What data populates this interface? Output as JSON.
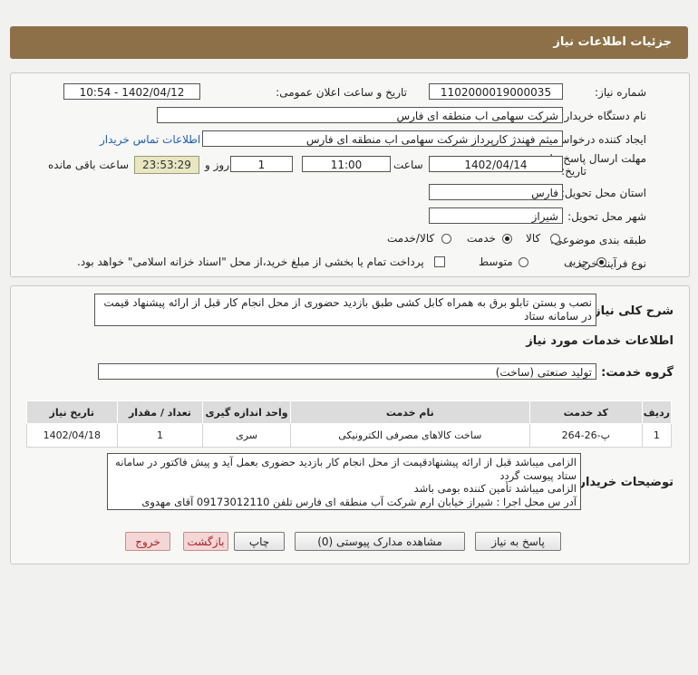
{
  "header": {
    "title": "جزئیات اطلاعات نیاز"
  },
  "form": {
    "need_number_label": "شماره نیاز:",
    "need_number": "1102000019000035",
    "announce_label": "تاریخ و ساعت اعلان عمومی:",
    "announce_value": "1402/04/12 - 10:54",
    "buyer_org_label": "نام دستگاه خریدار:",
    "buyer_org": "شرکت سهامی اب منطقه ای فارس",
    "requester_label": "ایجاد کننده درخواست:",
    "requester": "میثم فهندژ کارپرداز شرکت سهامی اب منطقه ای فارس",
    "contact_link": "اطلاعات تماس خریدار",
    "deadline_label_1": "مهلت ارسال پاسخ: تا",
    "deadline_label_2": "تاریخ:",
    "deadline_date": "1402/04/14",
    "time_label": "ساعت",
    "deadline_time": "11:00",
    "days_value": "1",
    "days_label": "روز و",
    "remaining_time": "23:53:29",
    "remaining_label": "ساعت باقی مانده",
    "province_label": "استان محل تحویل:",
    "province": "فارس",
    "city_label": "شهر محل تحویل:",
    "city": "شیراز",
    "category_label": "طبقه بندی موضوعی:",
    "category_options": [
      "کالا",
      "خدمت",
      "کالا/خدمت"
    ],
    "category_selected": "خدمت",
    "process_label": "نوع فرآیند خرید :",
    "process_options": [
      "جزیی",
      "متوسط"
    ],
    "process_selected": "جزیی",
    "payment_note": "پرداخت تمام یا بخشی از مبلغ خرید،از محل \"اسناد خزانه اسلامی\" خواهد بود."
  },
  "details": {
    "summary_label": "شرح کلی نیاز:",
    "summary": "نصب و بستن تابلو برق به همراه کابل کشی طبق بازدید حضوری از محل انجام کار قبل از ارائه پیشنهاد قیمت در سامانه ستاد",
    "services_title": "اطلاعات خدمات مورد نیاز",
    "service_group_label": "گروه خدمت:",
    "service_group": "تولید صنعتی (ساخت)",
    "table": {
      "headers": [
        "ردیف",
        "کد خدمت",
        "نام خدمت",
        "واحد اندازه گیری",
        "تعداد / مقدار",
        "تاریخ نیاز"
      ],
      "rows": [
        [
          "1",
          "پ-26-264",
          "ساخت کالاهای مصرفی الکترونیکی",
          "سری",
          "1",
          "1402/04/18"
        ]
      ]
    },
    "buyer_notes_label": "توضیحات خریدار:",
    "buyer_notes": [
      "الزامی میباشد قبل از ارائه پیشنهادقیمت از محل انجام کار بازدید حضوری بعمل آید و پیش فاکتور در سامانه ستاد پیوست گردد",
      "الزامی میباشد تأمین کننده بومی باشد",
      "آدر س محل اجرا : شیراز خیابان ارم شرکت آب منطقه ای فارس  تلفن 09173012110 آقای مهدوی"
    ]
  },
  "buttons": {
    "reply": "پاسخ به نیاز",
    "attachments": "مشاهده مدارک پیوستی (0)",
    "print": "چاپ",
    "back": "بازگشت",
    "exit": "خروج"
  },
  "colors": {
    "header_bg": "#8d7047",
    "contact_link": "#1f5fb0",
    "timer_bg": "#e9e6c2",
    "back_exit_bg": "#f3d6d6"
  }
}
